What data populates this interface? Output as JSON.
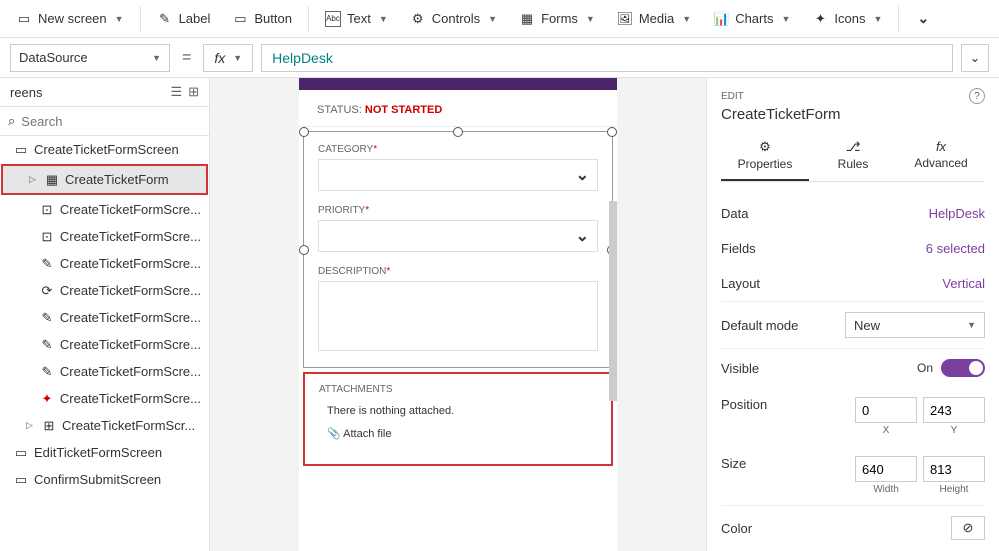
{
  "ribbon": {
    "new_screen": "New screen",
    "label": "Label",
    "button": "Button",
    "text": "Text",
    "controls": "Controls",
    "forms": "Forms",
    "media": "Media",
    "charts": "Charts",
    "icons": "Icons"
  },
  "formula": {
    "property": "DataSource",
    "fx": "fx",
    "value": "HelpDesk"
  },
  "tree": {
    "title": "reens",
    "search_placeholder": "Search",
    "items": [
      "CreateTicketFormScreen",
      "CreateTicketForm",
      "CreateTicketFormScre...",
      "CreateTicketFormScre...",
      "CreateTicketFormScre...",
      "CreateTicketFormScre...",
      "CreateTicketFormScre...",
      "CreateTicketFormScre...",
      "CreateTicketFormScre...",
      "CreateTicketFormScre...",
      "CreateTicketFormScr...",
      "EditTicketFormScreen",
      "ConfirmSubmitScreen"
    ]
  },
  "canvas": {
    "status_label": "STATUS:",
    "status_value": "NOT STARTED",
    "category": "CATEGORY",
    "priority": "PRIORITY",
    "description": "DESCRIPTION",
    "attachments": "ATTACHMENTS",
    "nothing_attached": "There is nothing attached.",
    "attach_file": "Attach file"
  },
  "props": {
    "edit": "EDIT",
    "title": "CreateTicketForm",
    "tabs": {
      "properties": "Properties",
      "rules": "Rules",
      "advanced": "Advanced"
    },
    "data_label": "Data",
    "data_value": "HelpDesk",
    "fields_label": "Fields",
    "fields_value": "6 selected",
    "layout_label": "Layout",
    "layout_value": "Vertical",
    "default_mode_label": "Default mode",
    "default_mode_value": "New",
    "visible_label": "Visible",
    "visible_value": "On",
    "position_label": "Position",
    "position_x": "0",
    "position_y": "243",
    "x": "X",
    "y": "Y",
    "size_label": "Size",
    "size_w": "640",
    "size_h": "813",
    "width": "Width",
    "height": "Height",
    "color_label": "Color"
  }
}
